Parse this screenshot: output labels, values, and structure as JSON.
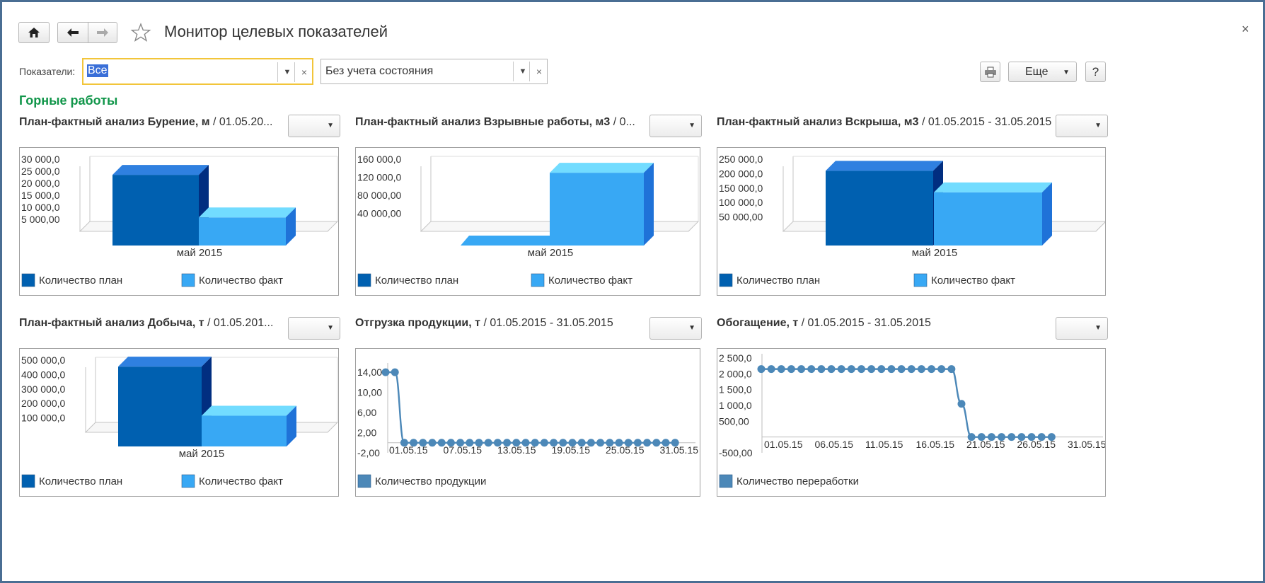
{
  "toolbar": {
    "title": "Монитор целевых показателей",
    "close_glyph": "×",
    "icons": [
      "home-icon",
      "back-arrow-icon",
      "forward-arrow-icon",
      "star-icon",
      "print-icon"
    ],
    "more_label": "Еще",
    "help_label": "?"
  },
  "filter": {
    "label": "Показатели:",
    "indicators_value": "Все",
    "state_value": "Без учета состояния",
    "clear_glyph": "×"
  },
  "section_title": "Горные работы",
  "colors": {
    "accent_green": "#11964a",
    "highlight_border": "#f2c53a",
    "series_dark": "#0060b0",
    "series_light": "#38a8f4",
    "line_color": "#4c88b8"
  },
  "panels": [
    {
      "title_bold": "План-фактный анализ Бурение, м",
      "title_rest": " / 01.05.20..."
    },
    {
      "title_bold": "План-фактный анализ Взрывные работы, м3",
      "title_rest": " / 0..."
    },
    {
      "title_bold": "План-фактный анализ Вскрыша, м3",
      "title_rest": " / 01.05.2015 - 31.05.2015"
    },
    {
      "title_bold": "План-фактный анализ Добыча, т",
      "title_rest": " / 01.05.201..."
    },
    {
      "title_bold": "Отгрузка продукции, т",
      "title_rest": " / 01.05.2015 - 31.05.2015"
    },
    {
      "title_bold": "Обогащение, т",
      "title_rest": " / 01.05.2015 - 31.05.2015"
    }
  ],
  "chart_data": [
    {
      "type": "bar",
      "categories": [
        "май 2015"
      ],
      "series": [
        {
          "name": "Количество план",
          "values": [
            23500
          ]
        },
        {
          "name": "Количество факт",
          "values": [
            5800
          ]
        }
      ],
      "ylim": [
        0,
        30000
      ],
      "yticks": [
        "30 000,0",
        "25 000,0",
        "20 000,0",
        "15 000,0",
        "10 000,0",
        "5 000,00"
      ],
      "ytick_values": [
        30000,
        25000,
        20000,
        15000,
        10000,
        5000
      ]
    },
    {
      "type": "bar",
      "categories": [
        "май 2015"
      ],
      "series": [
        {
          "name": "Количество план",
          "values": [
            0
          ]
        },
        {
          "name": "Количество факт",
          "values": [
            130000
          ]
        }
      ],
      "ylim": [
        0,
        160000
      ],
      "yticks": [
        "160 000,0",
        "120 000,0",
        "80 000,00",
        "40 000,00"
      ],
      "ytick_values": [
        160000,
        120000,
        80000,
        40000
      ]
    },
    {
      "type": "bar",
      "categories": [
        "май 2015"
      ],
      "series": [
        {
          "name": "Количество план",
          "values": [
            210000
          ]
        },
        {
          "name": "Количество факт",
          "values": [
            135000
          ]
        }
      ],
      "ylim": [
        0,
        250000
      ],
      "yticks": [
        "250 000,0",
        "200 000,0",
        "150 000,0",
        "100 000,0",
        "50 000,00"
      ],
      "ytick_values": [
        250000,
        200000,
        150000,
        100000,
        50000
      ]
    },
    {
      "type": "bar",
      "categories": [
        "май 2015"
      ],
      "series": [
        {
          "name": "Количество план",
          "values": [
            455000
          ]
        },
        {
          "name": "Количество факт",
          "values": [
            115000
          ]
        }
      ],
      "ylim": [
        0,
        500000
      ],
      "yticks": [
        "500 000,0",
        "400 000,0",
        "300 000,0",
        "200 000,0",
        "100 000,0"
      ],
      "ytick_values": [
        500000,
        400000,
        300000,
        200000,
        100000
      ]
    },
    {
      "type": "line",
      "x_ticks": [
        "01.05.15",
        "07.05.15",
        "13.05.15",
        "19.05.15",
        "25.05.15",
        "31.05.15"
      ],
      "yticks": [
        "14,00",
        "10,00",
        "6,00",
        "2,00",
        "-2,00"
      ],
      "ytick_values": [
        14,
        10,
        6,
        2,
        -2
      ],
      "ylim": [
        -2,
        15
      ],
      "series": [
        {
          "name": "Количество продукции",
          "x": [
            "29.04.15",
            "30.04.15",
            "01.05.15",
            "02.05.15",
            "03.05.15",
            "04.05.15",
            "05.05.15",
            "06.05.15",
            "07.05.15",
            "08.05.15",
            "09.05.15",
            "10.05.15",
            "11.05.15",
            "12.05.15",
            "13.05.15",
            "14.05.15",
            "15.05.15",
            "16.05.15",
            "17.05.15",
            "18.05.15",
            "19.05.15",
            "20.05.15",
            "21.05.15",
            "22.05.15",
            "23.05.15",
            "24.05.15",
            "25.05.15",
            "26.05.15",
            "27.05.15",
            "28.05.15",
            "29.05.15",
            "30.05.15"
          ],
          "values": [
            14,
            14,
            0,
            0,
            0,
            0,
            0,
            0,
            0,
            0,
            0,
            0,
            0,
            0,
            0,
            0,
            0,
            0,
            0,
            0,
            0,
            0,
            0,
            0,
            0,
            0,
            0,
            0,
            0,
            0,
            0,
            0
          ]
        }
      ]
    },
    {
      "type": "line",
      "x_ticks": [
        "01.05.15",
        "06.05.15",
        "11.05.15",
        "16.05.15",
        "21.05.15",
        "26.05.15",
        "31.05.15"
      ],
      "yticks": [
        "2 500,0",
        "2 000,0",
        "1 500,0",
        "1 000,0",
        "500,00",
        "-500,00"
      ],
      "ytick_values": [
        2500,
        2000,
        1500,
        1000,
        500,
        -500
      ],
      "ylim": [
        -500,
        2500
      ],
      "series": [
        {
          "name": "Количество переработки",
          "x": [
            "01.05.15",
            "02.05.15",
            "03.05.15",
            "04.05.15",
            "05.05.15",
            "06.05.15",
            "07.05.15",
            "08.05.15",
            "09.05.15",
            "10.05.15",
            "11.05.15",
            "12.05.15",
            "13.05.15",
            "14.05.15",
            "15.05.15",
            "16.05.15",
            "17.05.15",
            "18.05.15",
            "19.05.15",
            "20.05.15",
            "21.05.15",
            "22.05.15",
            "23.05.15",
            "24.05.15",
            "25.05.15",
            "26.05.15",
            "27.05.15",
            "28.05.15",
            "29.05.15",
            "30.05.15"
          ],
          "values": [
            2150,
            2150,
            2150,
            2150,
            2150,
            2150,
            2150,
            2150,
            2150,
            2150,
            2150,
            2150,
            2150,
            2150,
            2150,
            2150,
            2150,
            2150,
            2150,
            2150,
            1050,
            0,
            0,
            0,
            0,
            0,
            0,
            0,
            0,
            0
          ]
        }
      ]
    }
  ]
}
